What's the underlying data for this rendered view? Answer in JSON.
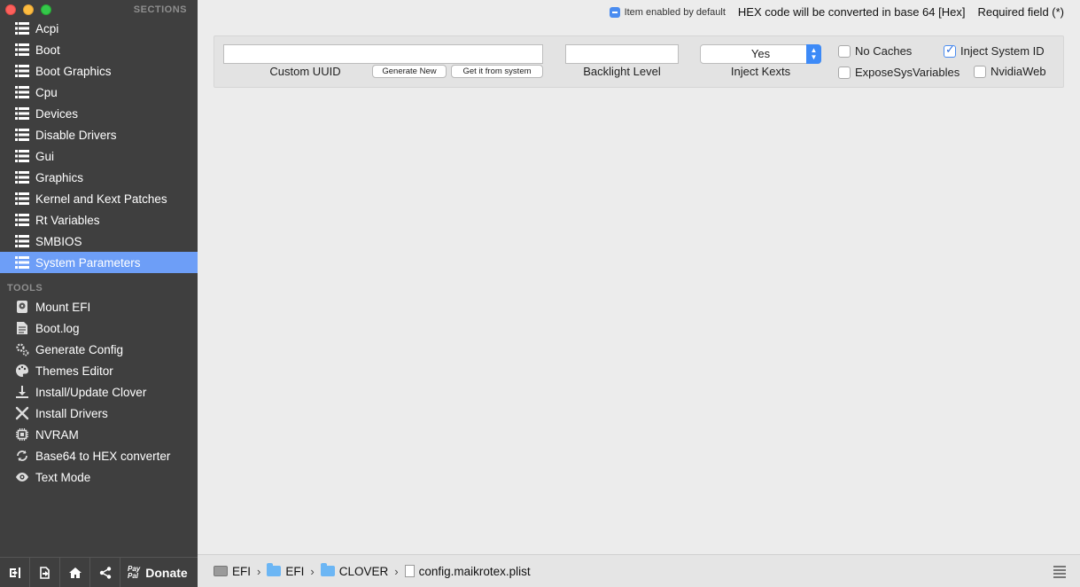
{
  "sidebar": {
    "sections_header": "SECTIONS",
    "tools_header": "TOOLS",
    "sections": [
      {
        "label": "Acpi",
        "icon": "list-icon"
      },
      {
        "label": "Boot",
        "icon": "list-icon"
      },
      {
        "label": "Boot Graphics",
        "icon": "list-icon"
      },
      {
        "label": "Cpu",
        "icon": "list-icon"
      },
      {
        "label": "Devices",
        "icon": "list-icon"
      },
      {
        "label": "Disable Drivers",
        "icon": "list-icon"
      },
      {
        "label": "Gui",
        "icon": "list-icon"
      },
      {
        "label": "Graphics",
        "icon": "list-icon"
      },
      {
        "label": "Kernel and Kext Patches",
        "icon": "list-icon"
      },
      {
        "label": "Rt Variables",
        "icon": "list-icon"
      },
      {
        "label": "SMBIOS",
        "icon": "list-icon"
      },
      {
        "label": "System Parameters",
        "icon": "list-icon",
        "selected": true
      }
    ],
    "tools": [
      {
        "label": "Mount EFI",
        "icon": "disk-icon"
      },
      {
        "label": "Boot.log",
        "icon": "log-icon"
      },
      {
        "label": "Generate Config",
        "icon": "gears-icon"
      },
      {
        "label": "Themes Editor",
        "icon": "palette-icon"
      },
      {
        "label": "Install/Update Clover",
        "icon": "download-icon"
      },
      {
        "label": "Install Drivers",
        "icon": "tools-icon"
      },
      {
        "label": "NVRAM",
        "icon": "chip-icon"
      },
      {
        "label": "Base64 to HEX converter",
        "icon": "refresh-icon"
      },
      {
        "label": "Text Mode",
        "icon": "eye-icon"
      }
    ],
    "footer": {
      "paypal_line1": "Pay",
      "paypal_line2": "Pal",
      "donate_label": "Donate"
    }
  },
  "topbar": {
    "item_enabled_label": "Item enabled by default",
    "hex_note": "HEX code will be converted in base 64 [Hex]",
    "required_note": "Required field (*)"
  },
  "panel": {
    "custom_uuid_value": "",
    "custom_uuid_label": "Custom UUID",
    "generate_new_label": "Generate New",
    "get_from_system_label": "Get it from system",
    "backlight_value": "",
    "backlight_label": "Backlight Level",
    "inject_kexts_value": "Yes",
    "inject_kexts_label": "Inject Kexts",
    "no_caches_label": "No Caches",
    "no_caches_checked": false,
    "inject_system_id_label": "Inject System ID",
    "inject_system_id_checked": true,
    "expose_sys_variables_label": "ExposeSysVariables",
    "expose_sys_variables_checked": false,
    "nvidia_web_label": "NvidiaWeb",
    "nvidia_web_checked": false
  },
  "statusbar": {
    "crumbs": [
      "EFI",
      "EFI",
      "CLOVER",
      "config.maikrotex.plist"
    ],
    "separator": "›"
  },
  "colors": {
    "sidebar_bg": "#3f3f3f",
    "selection": "#6d9ef7",
    "accent_blue": "#4a8cf0"
  }
}
